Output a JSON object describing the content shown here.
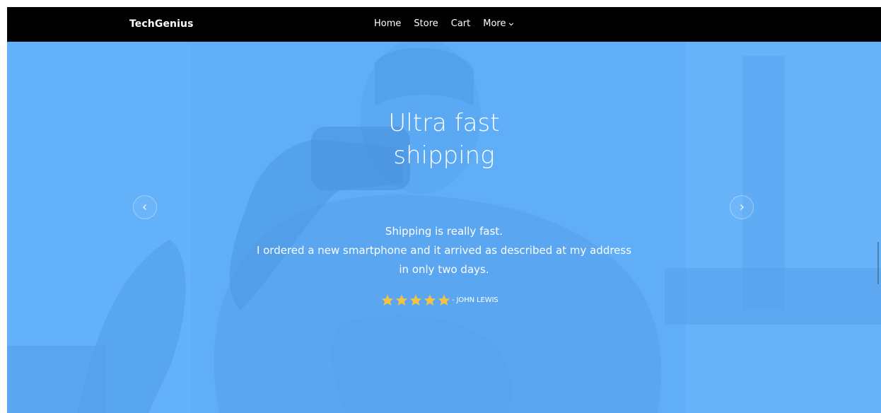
{
  "nav": {
    "brand": "TechGenius",
    "links": [
      "Home",
      "Store",
      "Cart",
      "More"
    ]
  },
  "hero": {
    "title_lines": [
      "Ultra fast",
      "shipping"
    ],
    "testimonial_lines": [
      "Shipping is really fast.",
      "I ordered a new smartphone and it arrived as described at my address",
      "in only two days."
    ],
    "rating": 5,
    "author": "- JOHN LEWIS"
  },
  "colors": {
    "navbar": "#000000",
    "hero_overlay": "#5eaaf6",
    "star": "#f5c243",
    "text": "#ffffff"
  },
  "icons": {
    "more_dropdown": "chevron-down-icon",
    "prev": "chevron-left-icon",
    "next": "chevron-right-icon",
    "rating": "star-icon"
  }
}
